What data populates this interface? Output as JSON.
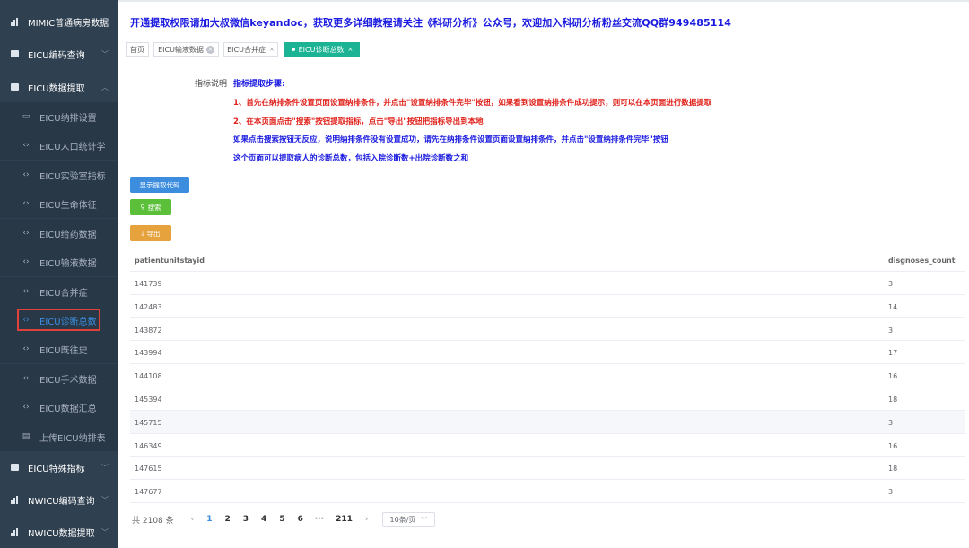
{
  "header": {
    "notice": "开通提取权限请加大叔微信keyandoc，获取更多详细教程请关注《科研分析》公众号，欢迎加入科研分析粉丝交流QQ群949485114"
  },
  "sidebar": {
    "items": [
      {
        "label": "MIMIC普通病房数据",
        "icon": "bar-chart-icon"
      },
      {
        "label": "EICU编码查询",
        "icon": "square-icon"
      },
      {
        "label": "EICU数据提取",
        "icon": "square-icon"
      },
      {
        "label": "EICU纳排设置",
        "icon": "monitor-icon"
      },
      {
        "label": "EICU人口统计学",
        "icon": "code-icon"
      },
      {
        "label": "EICU实验室指标",
        "icon": "code-icon"
      },
      {
        "label": "EICU生命体征",
        "icon": "code-icon"
      },
      {
        "label": "EICU给药数据",
        "icon": "code-icon"
      },
      {
        "label": "EICU输液数据",
        "icon": "code-icon"
      },
      {
        "label": "EICU合并症",
        "icon": "code-icon"
      },
      {
        "label": "EICU诊断总数",
        "icon": "code-icon"
      },
      {
        "label": "EICU既往史",
        "icon": "code-icon"
      },
      {
        "label": "EICU手术数据",
        "icon": "code-icon"
      },
      {
        "label": "EICU数据汇总",
        "icon": "code-icon"
      },
      {
        "label": "上传EICU纳排表",
        "icon": "table-icon"
      },
      {
        "label": "EICU特殊指标",
        "icon": "square-icon"
      },
      {
        "label": "NWICU编码查询",
        "icon": "bar-chart-icon"
      },
      {
        "label": "NWICU数据提取",
        "icon": "bar-chart-icon"
      }
    ]
  },
  "tabs": [
    {
      "label": "首页"
    },
    {
      "label": "EICU输液数据"
    },
    {
      "label": "EICU合并症"
    },
    {
      "label": "EICU诊断总数"
    }
  ],
  "instructions": {
    "label": "指标说明",
    "title": "指标提取步骤:",
    "step1": "1、首先在纳排条件设置页面设置纳排条件，并点击\"设置纳排条件完毕\"按钮，如果看到设置纳排条件成功提示，则可以在本页面进行数据提取",
    "step2": "2、在本页面点击\"搜索\"按钮提取指标，点击\"导出\"按钮把指标导出到本地",
    "note1": "如果点击搜索按钮无反应，说明纳排条件没有设置成功，请先在纳排条件设置页面设置纳排条件，并点击\"设置纳排条件完毕\"按钮",
    "note2": "这个页面可以提取病人的诊断总数，包括入院诊断数+出院诊断数之和"
  },
  "buttons": {
    "show_code": "显示提取代码",
    "search": "搜索",
    "export": "导出"
  },
  "table": {
    "columns": [
      "patientunitstayid",
      "disgnoses_count"
    ],
    "rows": [
      [
        "141739",
        "3"
      ],
      [
        "142483",
        "14"
      ],
      [
        "143872",
        "3"
      ],
      [
        "143994",
        "17"
      ],
      [
        "144108",
        "16"
      ],
      [
        "145394",
        "18"
      ],
      [
        "145715",
        "3"
      ],
      [
        "146349",
        "16"
      ],
      [
        "147615",
        "18"
      ],
      [
        "147677",
        "3"
      ]
    ]
  },
  "pagination": {
    "total": "共 2108 条",
    "pages": [
      "1",
      "2",
      "3",
      "4",
      "5",
      "6"
    ],
    "ellipsis": "···",
    "last": "211",
    "page_size": "10条/页"
  },
  "colors": {
    "sidebar_bg": "#2f4050",
    "active_tab": "#1ab394",
    "notice_blue": "#1a1ae0",
    "warning_red": "#e0201a",
    "highlight_box": "#e0413a"
  }
}
